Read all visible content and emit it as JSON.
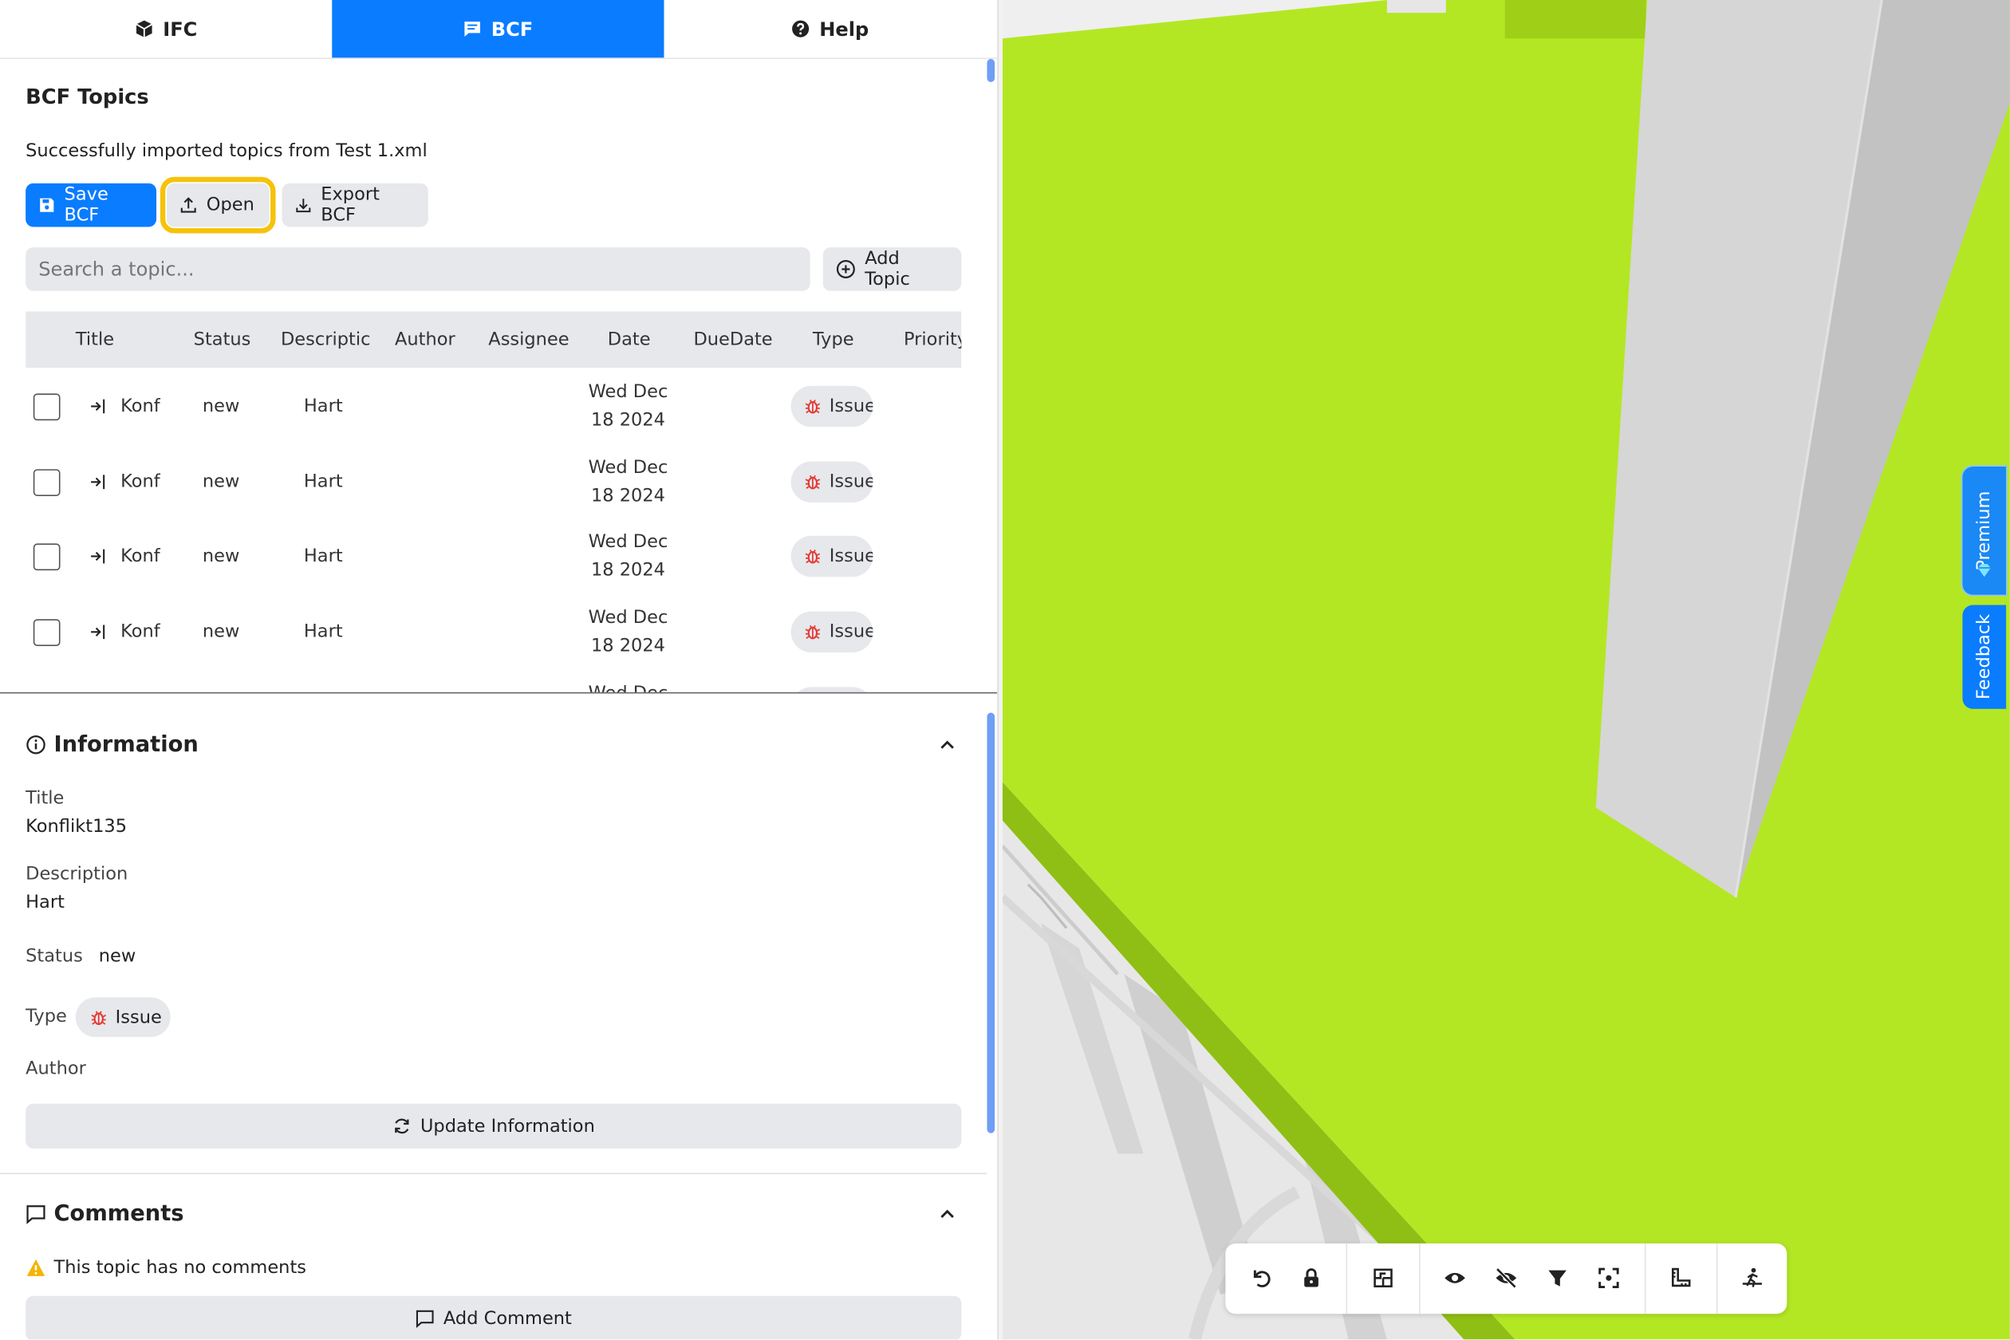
{
  "tabs": [
    {
      "label": "IFC",
      "icon": "cube-icon"
    },
    {
      "label": "BCF",
      "icon": "message-icon"
    },
    {
      "label": "Help",
      "icon": "question-icon"
    }
  ],
  "topics": {
    "title": "BCF Topics",
    "import_message": "Successfully imported topics from Test 1.xml",
    "save_label": "Save BCF",
    "open_label": "Open",
    "export_label": "Export BCF",
    "search_placeholder": "Search a topic...",
    "add_topic_label": "Add Topic",
    "columns": [
      "Title",
      "Status",
      "Descriptic",
      "Author",
      "Assignee",
      "Date",
      "DueDate",
      "Type",
      "Priority"
    ],
    "rows": [
      {
        "title": "Konf",
        "status": "new",
        "description": "Hart",
        "date_line1": "Wed Dec",
        "date_line2": "18 2024",
        "type": "Issue"
      },
      {
        "title": "Konf",
        "status": "new",
        "description": "Hart",
        "date_line1": "Wed Dec",
        "date_line2": "18 2024",
        "type": "Issue"
      },
      {
        "title": "Konf",
        "status": "new",
        "description": "Hart",
        "date_line1": "Wed Dec",
        "date_line2": "18 2024",
        "type": "Issue"
      },
      {
        "title": "Konf",
        "status": "new",
        "description": "Hart",
        "date_line1": "Wed Dec",
        "date_line2": "18 2024",
        "type": "Issue"
      },
      {
        "title": "",
        "status": "",
        "description": "",
        "date_line1": "Wed Dec",
        "date_line2": "",
        "type": ""
      }
    ]
  },
  "information": {
    "heading": "Information",
    "title_label": "Title",
    "title_value": "Konflikt135",
    "description_label": "Description",
    "description_value": "Hart",
    "status_label": "Status",
    "status_value": "new",
    "type_label": "Type",
    "type_value": "Issue",
    "author_label": "Author",
    "update_label": "Update Information"
  },
  "comments": {
    "heading": "Comments",
    "empty_message": "This topic has no comments",
    "add_label": "Add Comment"
  },
  "viewer": {
    "premium_label": "Premium",
    "feedback_label": "Feedback",
    "toolbar_icons": [
      "undo-icon",
      "lock-icon",
      "section-icon",
      "eye-icon",
      "eye-off-icon",
      "filter-icon",
      "focus-icon",
      "measure-icon",
      "walk-icon"
    ]
  },
  "colors": {
    "accent": "#0a7cff",
    "highlight": "#f6c20a",
    "floor": "#b3e724",
    "issue": "#e53935"
  }
}
